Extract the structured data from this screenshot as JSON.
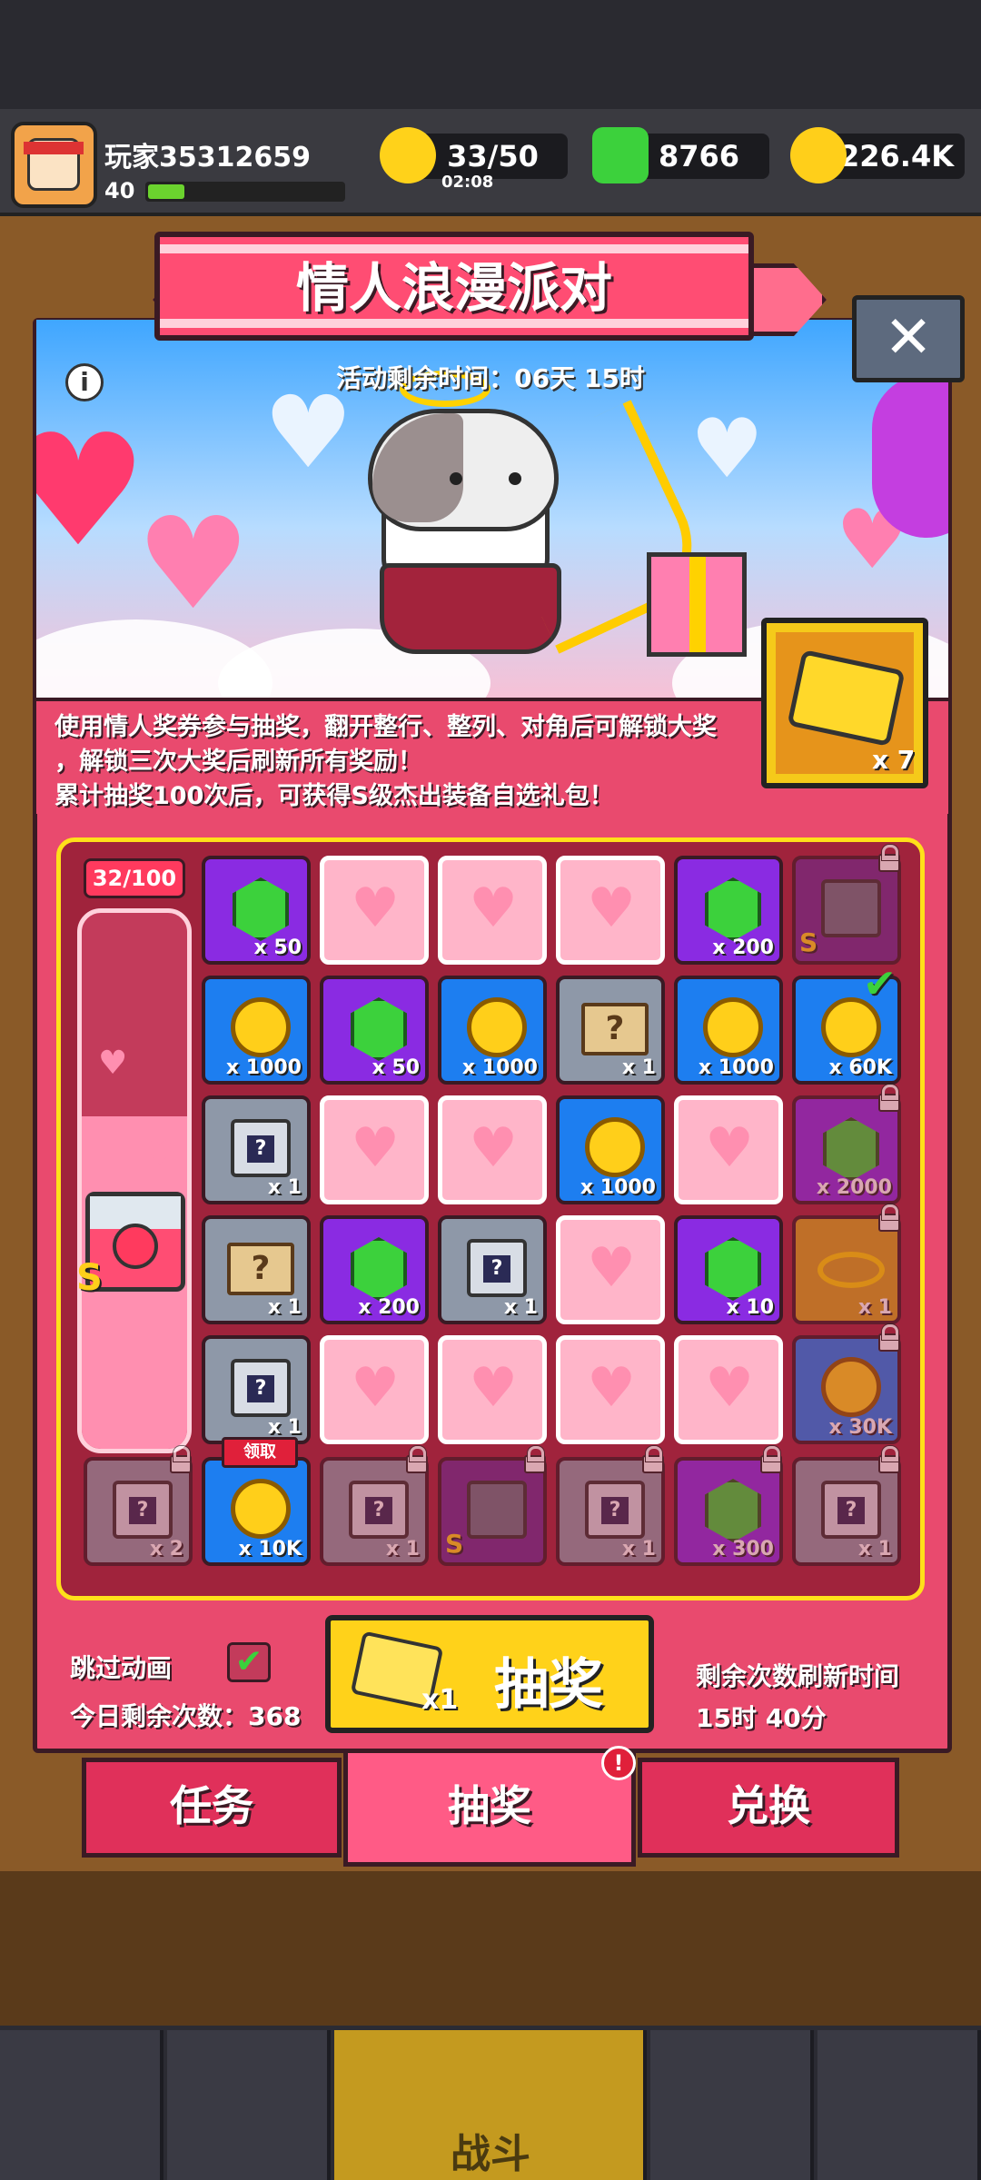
{
  "player": {
    "name": "玩家35312659",
    "level": "40"
  },
  "resources": {
    "energy": "33/50",
    "energy_timer": "02:08",
    "gems": "8766",
    "coins": "226.4K"
  },
  "event": {
    "title": "情人浪漫派对",
    "timer": "活动剩余时间：06天 15时",
    "desc_line1": "使用情人奖券参与抽奖，翻开整行、整列、对角后可解锁大奖",
    "desc_line2": "，解锁三次大奖后刷新所有奖励！",
    "desc_line3": "累计抽奖100次后，可获得S级杰出装备自选礼包！",
    "ticket_count": "x 7"
  },
  "progress": {
    "label": "32/100",
    "fraction": 0.32
  },
  "grid": [
    [
      {
        "t": "gem",
        "q": "x 50"
      },
      {
        "t": "heart"
      },
      {
        "t": "heart"
      },
      {
        "t": "heart"
      },
      {
        "t": "gem",
        "q": "x 200"
      },
      {
        "t": "equip",
        "q": "",
        "lock": true,
        "s": "S"
      }
    ],
    [
      {
        "t": "coin",
        "q": "x 1000"
      },
      {
        "t": "gem",
        "q": "x 50"
      },
      {
        "t": "coin",
        "q": "x 1000"
      },
      {
        "t": "scroll",
        "q": "x 1"
      },
      {
        "t": "coin",
        "q": "x 1000"
      },
      {
        "t": "coin",
        "q": "x 60K",
        "check": true
      }
    ],
    [
      {
        "t": "box",
        "q": "x 1"
      },
      {
        "t": "heart"
      },
      {
        "t": "heart"
      },
      {
        "t": "coin",
        "q": "x 1000"
      },
      {
        "t": "heart"
      },
      {
        "t": "gem",
        "q": "x 2000",
        "lock": true
      }
    ],
    [
      {
        "t": "scroll",
        "q": "x 1"
      },
      {
        "t": "gem",
        "q": "x 200"
      },
      {
        "t": "box",
        "q": "x 1"
      },
      {
        "t": "heart"
      },
      {
        "t": "gem",
        "q": "x 10"
      },
      {
        "t": "ring",
        "q": "x 1",
        "lock": true
      }
    ],
    [
      {
        "t": "box",
        "q": "x 1"
      },
      {
        "t": "heart"
      },
      {
        "t": "heart"
      },
      {
        "t": "heart"
      },
      {
        "t": "heart"
      },
      {
        "t": "coin",
        "q": "x 30K",
        "lock": true
      }
    ]
  ],
  "bottom_row": [
    {
      "t": "box",
      "q": "x 2",
      "lock": true
    },
    {
      "t": "coin",
      "q": "x 10K",
      "claim": "领取"
    },
    {
      "t": "box",
      "q": "x 1",
      "lock": true
    },
    {
      "t": "equip",
      "q": "",
      "lock": true,
      "s": "S"
    },
    {
      "t": "box",
      "q": "x 1",
      "lock": true
    },
    {
      "t": "gem",
      "q": "x 300",
      "lock": true
    },
    {
      "t": "box",
      "q": "x 1",
      "lock": true
    }
  ],
  "controls": {
    "skip_label": "跳过动画",
    "skip_checked": "✔",
    "today_left": "今日剩余次数：368",
    "draw_x": "x1",
    "draw_label": "抽奖",
    "refresh_label": "剩余次数刷新时间",
    "refresh_time": "15时 40分"
  },
  "tabs": [
    {
      "label": "任务"
    },
    {
      "label": "抽奖",
      "badge": "!"
    },
    {
      "label": "兑换"
    }
  ],
  "nav": {
    "battle": "战斗"
  },
  "icons": {
    "close": "✕",
    "info": "i",
    "heart": "♥",
    "check": "✔"
  },
  "colors": {
    "accent": "#e94a6e",
    "board": "#a0233c",
    "border_gold": "#ffe01a"
  }
}
